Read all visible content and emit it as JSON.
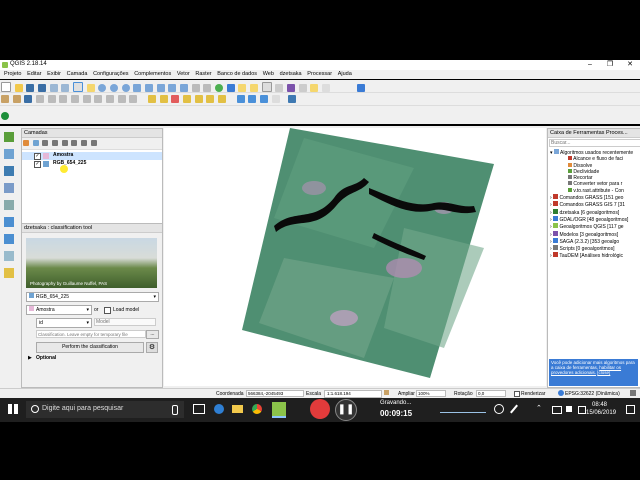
{
  "window": {
    "title": "QGIS 2.18.14"
  },
  "menu": [
    "Projeto",
    "Editar",
    "Exibir",
    "Camada",
    "Configurações",
    "Complementos",
    "Vetor",
    "Raster",
    "Banco de dados",
    "Web",
    "dzetsaka",
    "Processar",
    "Ajuda"
  ],
  "layers_panel": {
    "title": "Camadas",
    "layers": [
      {
        "name": "Amostra",
        "checked": true,
        "selected": true
      },
      {
        "name": "RGB_654_225",
        "checked": true,
        "selected": false
      }
    ]
  },
  "dzetsaka_panel": {
    "title": "dzetsaka : classification tool",
    "photo_credit": "Photography by Guillaume Nuffel, PAS",
    "raster_select": "RGB_654_225",
    "vector_select": "Amostra",
    "or_label": "or",
    "load_model_label": "Load model",
    "field_select": "id",
    "model_placeholder": "Model",
    "output_placeholder": "Classification. Leave empty for temporary file",
    "browse_label": "...",
    "perform_button": "Perform the classification",
    "optional_label": "Optional"
  },
  "processing_panel": {
    "title": "Caixa de Ferramentas Proces...",
    "search_placeholder": "Buscar...",
    "recent_group": "Algoritmos usados recentemente",
    "recent_items": [
      "Alcance e fluxo de faci",
      "Dissolve",
      "Declividade",
      "Recortar",
      "Converter vetor para r",
      "v.to.rast.attribute - Con"
    ],
    "groups": [
      "Comandos GRASS [151 geo",
      "Comandos GRASS GIS 7 [31",
      "dzetsaka [6 geoalgoritmos]",
      "GDAL/OGR [48 geoalgoritmos]",
      "Geoalgoritmos QGIS [117 ge",
      "Modelos [3 geoalgoritmos]",
      "SAGA (2.3.2) [353 geoalgo",
      "Scripts [0 geoalgoritmos]",
      "TauDEM [Análises hidrológic"
    ],
    "info_text": "Você pode adicionar mais algoritmos para a caixa de ferramentas,",
    "info_link": "habilitar os provedores adicionais.",
    "info_close": "[close]"
  },
  "statusbar": {
    "coord_label": "Coordenada",
    "coord_value": "566384,-2045493",
    "scale_label": "Escala",
    "scale_value": "1:1.618.194",
    "zoom_label": "Ampliar",
    "zoom_value": "100%",
    "rotation_label": "Rotação",
    "rotation_value": "0,0",
    "render_label": "Renderizar",
    "epsg_label": "EPSG:32622 (Dinâmica)"
  },
  "taskbar": {
    "search_placeholder": "Digite aqui para pesquisar",
    "recording_label": "Gravando...",
    "recording_time": "00:09:15",
    "clock_time": "08:48",
    "clock_date": "15/06/2019"
  },
  "colors": {
    "accent": "#3a7bd5",
    "selected_layer": "#cde4ff",
    "taskbar": "#1f1f1f",
    "record": "#e23b3b"
  }
}
